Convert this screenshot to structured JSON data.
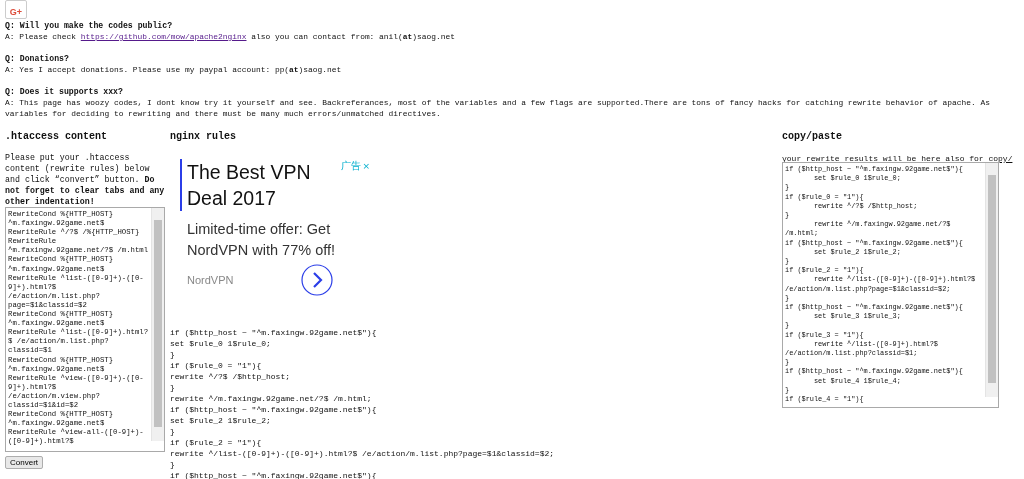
{
  "share_button": {
    "label": "G+"
  },
  "faq": [
    {
      "question": "Q: Will you make the codes public?",
      "answer": [
        [
          {
            "kind": "text",
            "text": "A: Please check "
          },
          {
            "kind": "link",
            "text": "https://github.com/mow/apache2nginx"
          },
          {
            "kind": "text",
            "text": " also you can contact from: anil(**at**)saog.net"
          }
        ]
      ]
    },
    {
      "question": "Q: Donations?",
      "answer": [
        [
          {
            "kind": "text",
            "text": "A: Yes I accept donations. Please use my paypal account: pp(**at**)saog.net"
          }
        ]
      ]
    },
    {
      "question": "Q: Does it supports xxx?",
      "answer": [
        [
          {
            "kind": "text",
            "text": "A: This page has woozy codes, I dont know try it yourself and see. Backreferances, most of the variables and a few flags are supported.There are tons of fancy hacks for catching rewrite behavior of apache. As"
          }
        ],
        [
          {
            "kind": "text",
            "text": "variables for deciding to rewriting and there must be many much errors/unmatched directives."
          }
        ]
      ]
    }
  ],
  "htaccess": {
    "title": ".htaccess content",
    "instructions": "Please put your .htaccess content (rewrite rules) below and click “convert” button. **Do not forget to clear tabs and any other indentation!**",
    "lines": [
      "RewriteCond %{HTTP_HOST}",
      "^m.faxingw.92game.net$",
      "RewriteRule ^/?$ /%{HTTP_HOST}",
      "RewriteRule",
      "^m.faxingw.92game.net/?$ /m.html",
      "RewriteCond %{HTTP_HOST}",
      "^m.faxingw.92game.net$",
      "RewriteRule ^list-([0-9]+)-([0-",
      "9]+).html?$",
      "/e/action/m.list.php?",
      "page=$1&classid=$2",
      "RewriteCond %{HTTP_HOST}",
      "^m.faxingw.92game.net$",
      "RewriteRule ^list-([0-9]+).html?",
      "$ /e/action/m.list.php?",
      "classid=$1",
      "RewriteCond %{HTTP_HOST}",
      "^m.faxingw.92game.net$",
      "RewriteRule ^view-([0-9]+)-([0-",
      "9]+).html?$",
      "/e/action/m.view.php?",
      "classid=$1&id=$2",
      "RewriteCond %{HTTP_HOST}",
      "^m.faxingw.92game.net$",
      "RewriteRule ^view-all-([0-9]+)-",
      "([0-9]+).html?$"
    ],
    "button": "Convert"
  },
  "nginx": {
    "title": "nginx rules",
    "ad": {
      "badge": "广告",
      "close": "×",
      "headline": "The Best VPN Deal 2017",
      "body": "Limited-time offer: Get NordVPN with 77% off!",
      "advertiser": "NordVPN"
    },
    "lines": [
      "if ($http_host ~ \"^m.faxingw.92game.net$\"){",
      "set $rule_0 1$rule_0;",
      "}",
      "if ($rule_0 = \"1\"){",
      "rewrite ^/?$ /$http_host;",
      "}",
      "rewrite ^/m.faxingw.92game.net/?$ /m.html;",
      "if ($http_host ~ \"^m.faxingw.92game.net$\"){",
      "set $rule_2 1$rule_2;",
      "}",
      "if ($rule_2 = \"1\"){",
      "rewrite ^/list-([0-9]+)-([0-9]+).html?$ /e/action/m.list.php?page=$1&classid=$2;",
      "}",
      "if ($http_host ~ \"^m.faxingw.92game.net$\"){"
    ]
  },
  "copy": {
    "title": "copy/paste",
    "hint": "your rewrite results will be here also for copy/",
    "lines": [
      "if ($http_host ~ \"^m.faxingw.92game.net$\"){",
      "\tset $rule_0 1$rule_0;",
      "}",
      "if ($rule_0 = \"1\"){",
      "\trewrite ^/?$ /$http_host;",
      "}",
      "\trewrite ^/m.faxingw.92game.net/?$",
      "/m.html;",
      "if ($http_host ~ \"^m.faxingw.92game.net$\"){",
      "\tset $rule_2 1$rule_2;",
      "}",
      "if ($rule_2 = \"1\"){",
      "\trewrite ^/list-([0-9]+)-([0-9]+).html?$",
      "/e/action/m.list.php?page=$1&classid=$2;",
      "}",
      "if ($http_host ~ \"^m.faxingw.92game.net$\"){",
      "\tset $rule_3 1$rule_3;",
      "}",
      "if ($rule_3 = \"1\"){",
      "\trewrite ^/list-([0-9]+).html?$",
      "/e/action/m.list.php?classid=$1;",
      "}",
      "if ($http_host ~ \"^m.faxingw.92game.net$\"){",
      "\tset $rule_4 1$rule_4;",
      "}",
      "if ($rule_4 = \"1\"){"
    ]
  }
}
